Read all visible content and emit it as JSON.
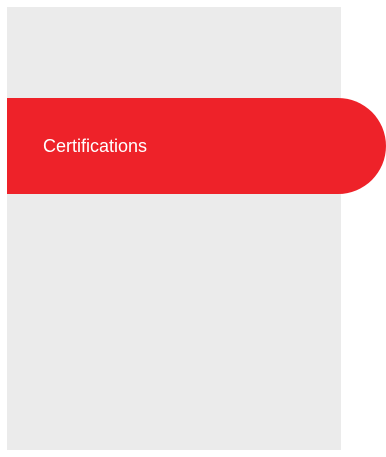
{
  "sidebar": {
    "background_color": "#ebebeb",
    "active_item": {
      "label": "Certifications",
      "background_color": "#ee2229",
      "text_color": "#ffffff"
    }
  }
}
